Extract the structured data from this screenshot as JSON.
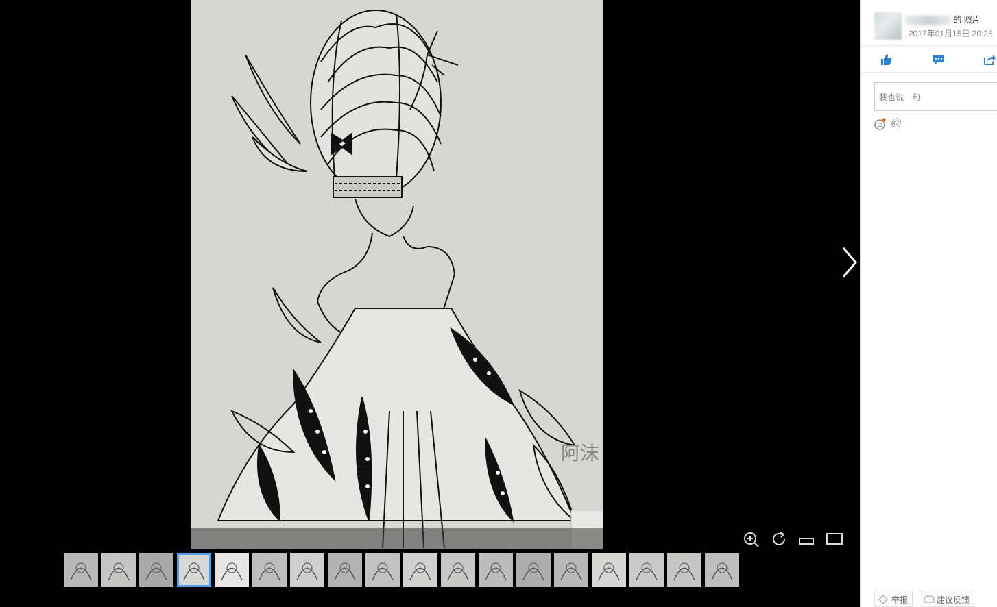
{
  "sidebar": {
    "author_suffix": "的 照片",
    "date": "2017年01月15日  20:25",
    "comment_placeholder": "我也说一句",
    "report_label": "举报",
    "feedback_label": "建议反馈"
  },
  "photo": {
    "signature": "阿沫"
  },
  "thumbnails": {
    "count": 18,
    "active_index": 3
  },
  "colors": {
    "accent": "#2b7fd9",
    "active_thumb_border": "#4aa3ef"
  }
}
